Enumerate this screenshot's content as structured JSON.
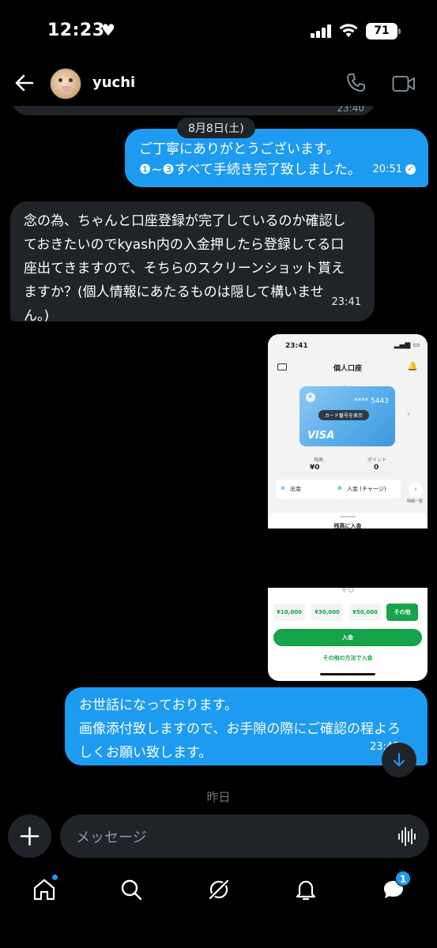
{
  "status_bar": {
    "time": "12:23",
    "battery": "71"
  },
  "header": {
    "contact_name": "yuchi"
  },
  "chat": {
    "previous_time": "23:40",
    "date_separator": "8月8日(土)",
    "messages": [
      {
        "direction": "out",
        "lines": [
          "ご丁寧にありがとうございます。",
          "❶~❸すべて手続き完了致しました。"
        ],
        "time": "20:51"
      },
      {
        "direction": "in",
        "lines": [
          "念の為、ちゃんと口座登録が完了しているのか確認し",
          "ておきたいのでkyash内の入金押したら登録してる口",
          "座出てきますので、そちらのスクリーンショット貰え",
          "ますか？(個人情報にあたるものは隠して構いませ",
          "ん。)"
        ],
        "time": "23:41"
      },
      {
        "direction": "out",
        "lines": [
          "お世話になっております。",
          "画像添付致しますので、お手隙の際にご確認の程よろ",
          "しくお願い致します。"
        ],
        "time": "23:45"
      }
    ],
    "attachment_top": {
      "status_time": "23:41",
      "title": "個人口座",
      "card_number": "**** 5443",
      "card_button": "カード番号を表示",
      "card_brand": "VISA",
      "balance_label": "残高",
      "balance_value": "¥0",
      "points_label": "ポイント",
      "points_value": "0",
      "withdraw_label": "出金",
      "deposit_label": "入金 (チャージ)",
      "history_label": "明細一覧",
      "sheet_title": "残高に入金"
    },
    "attachment_bottom": {
      "yen": "¥0",
      "amounts": [
        "¥10,000",
        "¥30,000",
        "¥50,000",
        "その他"
      ],
      "deposit_button": "入金",
      "other_methods": "その他の方法で入金"
    },
    "day_label": "昨日"
  },
  "composer": {
    "placeholder": "メッセージ"
  },
  "tabbar": {
    "messages_badge": "1"
  },
  "colors": {
    "accent": "#1d9bf0",
    "bubble_in": "#202327",
    "background": "#000000"
  }
}
